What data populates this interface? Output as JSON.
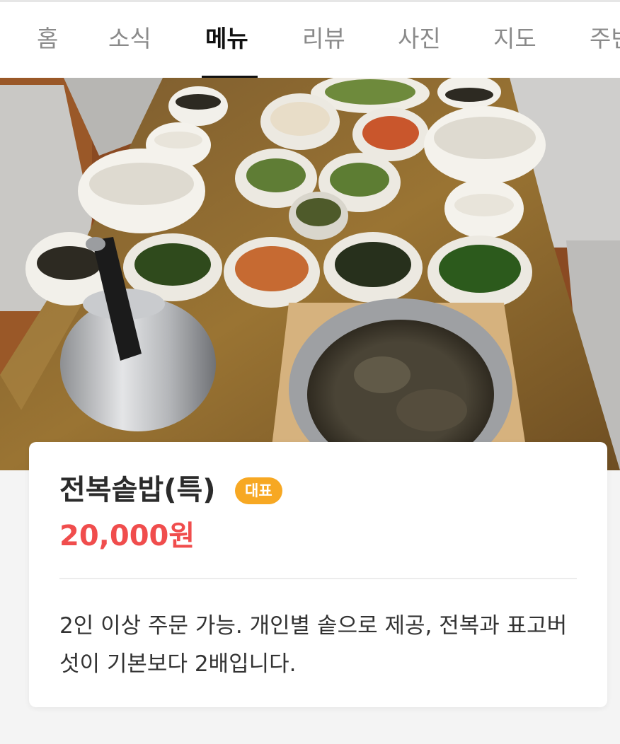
{
  "tabs": [
    {
      "label": "홈",
      "active": false
    },
    {
      "label": "소식",
      "active": false
    },
    {
      "label": "메뉴",
      "active": true
    },
    {
      "label": "리뷰",
      "active": false
    },
    {
      "label": "사진",
      "active": false
    },
    {
      "label": "지도",
      "active": false
    },
    {
      "label": "주변",
      "active": false
    }
  ],
  "menu": {
    "name": "전복솥밥(특)",
    "badge": "대표",
    "price": "20,000원",
    "description": "2인 이상 주문 가능. 개인별 솥으로 제공, 전복과 표고버섯이 기본보다 2배입니다."
  },
  "colors": {
    "price": "#f04d4d",
    "badge_bg": "#f7a823",
    "active_tab": "#111111",
    "inactive_tab": "#8a8a8a"
  }
}
